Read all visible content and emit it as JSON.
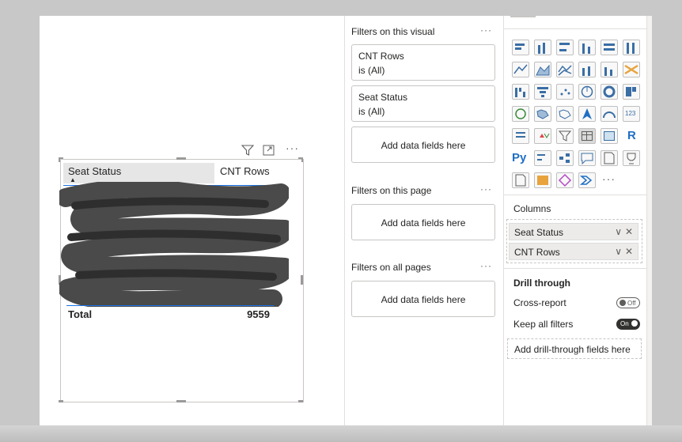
{
  "table": {
    "col1": "Seat Status",
    "col2": "CNT Rows",
    "total_label": "Total",
    "total_value": "9559"
  },
  "filters": {
    "visual_title": "Filters on this visual",
    "page_title": "Filters on this page",
    "all_title": "Filters on all pages",
    "more": "···",
    "cards": [
      {
        "field": "CNT Rows",
        "cond": "is (All)"
      },
      {
        "field": "Seat Status",
        "cond": "is (All)"
      }
    ],
    "add_label": "Add data fields here"
  },
  "viz": {
    "r_label": "R",
    "py_label": "Py",
    "kpi_label": "123",
    "more": "···",
    "columns_title": "Columns",
    "wells": [
      "Seat Status",
      "CNT Rows"
    ],
    "drill_title": "Drill through",
    "cross_report": "Cross-report",
    "cross_state": "Off",
    "keep_filters": "Keep all filters",
    "keep_state": "On",
    "drill_add": "Add drill-through fields here"
  },
  "colors": {
    "accent": "#1a73e8",
    "panel": "#ffffff",
    "backdrop": "#c8c8c8"
  }
}
